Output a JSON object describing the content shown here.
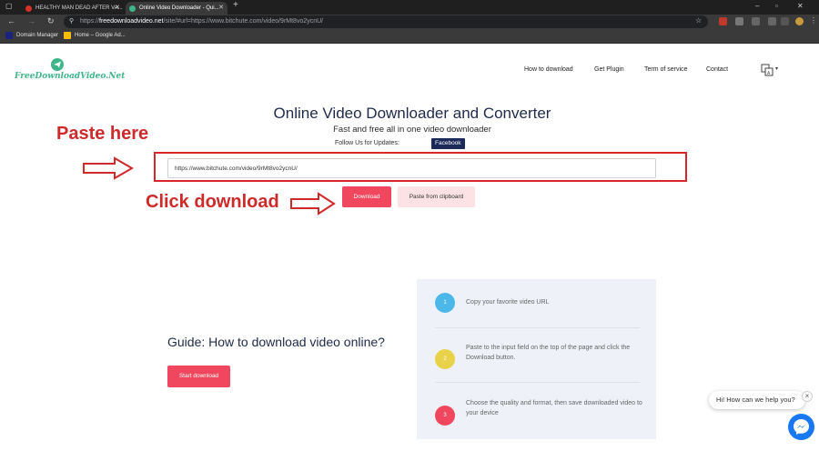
{
  "browser": {
    "tabs": [
      {
        "title": "HEALTHY MAN DEAD AFTER VA...",
        "active": false,
        "favicon_color": "#d93025"
      },
      {
        "title": "Online Video Downloader - Qui...",
        "active": true,
        "favicon_color": "#3fb58a"
      }
    ],
    "new_tab_label": "+",
    "url_prefix": "https://",
    "url_host": "freedownloadvideo.net",
    "url_rest": "/site/#url=https://www.bitchute.com/video/9rMt8vo2ycnU/",
    "bookmarks": [
      {
        "label": "Domain Manager",
        "icon": "domain-manager-icon"
      },
      {
        "label": "Home – Google Ad...",
        "icon": "google-ads-icon"
      }
    ]
  },
  "site": {
    "logo_text": "FreeDownloadVideo.Net",
    "nav": [
      "How to download",
      "Get Plugin",
      "Term of service",
      "Contact"
    ],
    "title": "Online Video Downloader and Converter",
    "subtitle": "Fast and free all in one video downloader",
    "follow_label": "Follow Us for Updates:",
    "facebook_label": "Facebook",
    "url_value": "https://www.bitchute.com/video/9rMt8vo2ycnU/",
    "download_label": "Download",
    "paste_label": "Paste from clipboard",
    "guide_title": "Guide: How to download video online?",
    "start_label": "Start download",
    "steps": [
      {
        "num": "1",
        "text": "Copy your favorite video URL",
        "color": "#4cb8ea"
      },
      {
        "num": "2",
        "text": "Paste to the input field on the top of the page and click the Download button.",
        "color": "#e8d24a"
      },
      {
        "num": "3",
        "text": "Choose the quality and format, then save downloaded video to your device",
        "color": "#f0475e"
      }
    ],
    "chat_prompt": "Hi! How can we help you?"
  },
  "annotations": {
    "paste_here": "Paste here",
    "click_download": "Click download"
  },
  "colors": {
    "accent": "#f0475e",
    "annotation": "#cf2a2a",
    "brand_green": "#3fb58a"
  }
}
